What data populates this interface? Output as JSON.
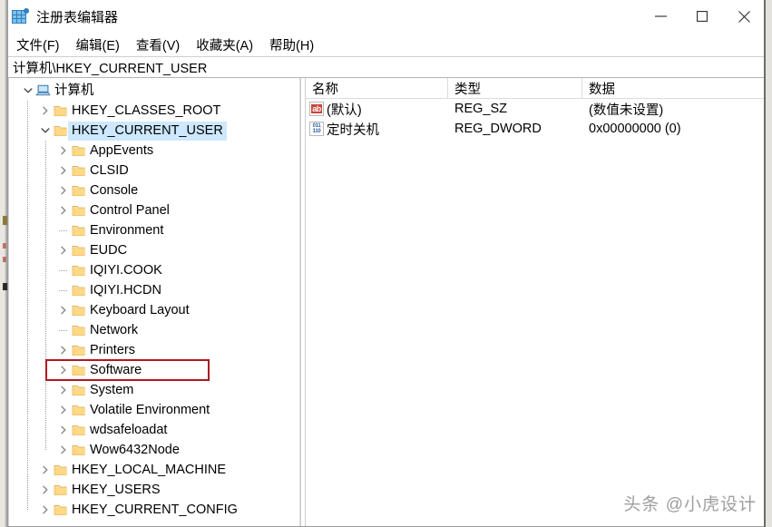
{
  "window": {
    "title": "注册表编辑器",
    "app_icon": "registry-grid-icon",
    "controls": {
      "minimize": "minimize-icon",
      "maximize": "maximize-icon",
      "close": "close-icon"
    }
  },
  "menubar": {
    "items": [
      {
        "label": "文件(F)"
      },
      {
        "label": "编辑(E)"
      },
      {
        "label": "查看(V)"
      },
      {
        "label": "收藏夹(A)"
      },
      {
        "label": "帮助(H)"
      }
    ]
  },
  "addressbar": {
    "path": "计算机\\HKEY_CURRENT_USER"
  },
  "tree": {
    "nodes": [
      {
        "label": "计算机",
        "level": 0,
        "expanded": true,
        "leaf": false,
        "icon": "computer-icon",
        "selected": false
      },
      {
        "label": "HKEY_CLASSES_ROOT",
        "level": 1,
        "expanded": false,
        "leaf": false,
        "icon": "folder-icon",
        "selected": false
      },
      {
        "label": "HKEY_CURRENT_USER",
        "level": 1,
        "expanded": true,
        "leaf": false,
        "icon": "folder-icon",
        "selected": true
      },
      {
        "label": "AppEvents",
        "level": 2,
        "expanded": false,
        "leaf": false,
        "icon": "folder-icon",
        "selected": false
      },
      {
        "label": "CLSID",
        "level": 2,
        "expanded": false,
        "leaf": false,
        "icon": "folder-icon",
        "selected": false
      },
      {
        "label": "Console",
        "level": 2,
        "expanded": false,
        "leaf": false,
        "icon": "folder-icon",
        "selected": false
      },
      {
        "label": "Control Panel",
        "level": 2,
        "expanded": false,
        "leaf": false,
        "icon": "folder-icon",
        "selected": false
      },
      {
        "label": "Environment",
        "level": 2,
        "expanded": false,
        "leaf": true,
        "icon": "folder-icon",
        "selected": false
      },
      {
        "label": "EUDC",
        "level": 2,
        "expanded": false,
        "leaf": false,
        "icon": "folder-icon",
        "selected": false
      },
      {
        "label": "IQIYI.COOK",
        "level": 2,
        "expanded": false,
        "leaf": true,
        "icon": "folder-icon",
        "selected": false
      },
      {
        "label": "IQIYI.HCDN",
        "level": 2,
        "expanded": false,
        "leaf": true,
        "icon": "folder-icon",
        "selected": false
      },
      {
        "label": "Keyboard Layout",
        "level": 2,
        "expanded": false,
        "leaf": false,
        "icon": "folder-icon",
        "selected": false
      },
      {
        "label": "Network",
        "level": 2,
        "expanded": false,
        "leaf": true,
        "icon": "folder-icon",
        "selected": false
      },
      {
        "label": "Printers",
        "level": 2,
        "expanded": false,
        "leaf": false,
        "icon": "folder-icon",
        "selected": false
      },
      {
        "label": "Software",
        "level": 2,
        "expanded": false,
        "leaf": false,
        "icon": "folder-icon",
        "selected": false,
        "annotated": true
      },
      {
        "label": "System",
        "level": 2,
        "expanded": false,
        "leaf": false,
        "icon": "folder-icon",
        "selected": false
      },
      {
        "label": "Volatile Environment",
        "level": 2,
        "expanded": false,
        "leaf": false,
        "icon": "folder-icon",
        "selected": false
      },
      {
        "label": "wdsafeloadat",
        "level": 2,
        "expanded": false,
        "leaf": false,
        "icon": "folder-icon",
        "selected": false
      },
      {
        "label": "Wow6432Node",
        "level": 2,
        "expanded": false,
        "leaf": false,
        "icon": "folder-icon",
        "selected": false
      },
      {
        "label": "HKEY_LOCAL_MACHINE",
        "level": 1,
        "expanded": false,
        "leaf": false,
        "icon": "folder-icon",
        "selected": false
      },
      {
        "label": "HKEY_USERS",
        "level": 1,
        "expanded": false,
        "leaf": false,
        "icon": "folder-icon",
        "selected": false
      },
      {
        "label": "HKEY_CURRENT_CONFIG",
        "level": 1,
        "expanded": false,
        "leaf": false,
        "icon": "folder-icon",
        "selected": false
      }
    ]
  },
  "values_list": {
    "columns": [
      {
        "label": "名称"
      },
      {
        "label": "类型"
      },
      {
        "label": "数据"
      }
    ],
    "rows": [
      {
        "name": "(默认)",
        "type": "REG_SZ",
        "data": "(数值未设置)",
        "icon": "string-value-icon"
      },
      {
        "name": "定时关机",
        "type": "REG_DWORD",
        "data": "0x00000000 (0)",
        "icon": "dword-value-icon"
      }
    ]
  },
  "annotation": {
    "color": "#b01820",
    "target": "Software"
  },
  "watermark": {
    "text": "头条 @小虎设计"
  },
  "colors": {
    "selection": "#cde8ff",
    "folder_fill": "#ffe09a",
    "folder_edge": "#e0b150",
    "annotation_red": "#b01820",
    "chrome_white": "#ffffff",
    "border_gray": "#9a9a9a"
  }
}
